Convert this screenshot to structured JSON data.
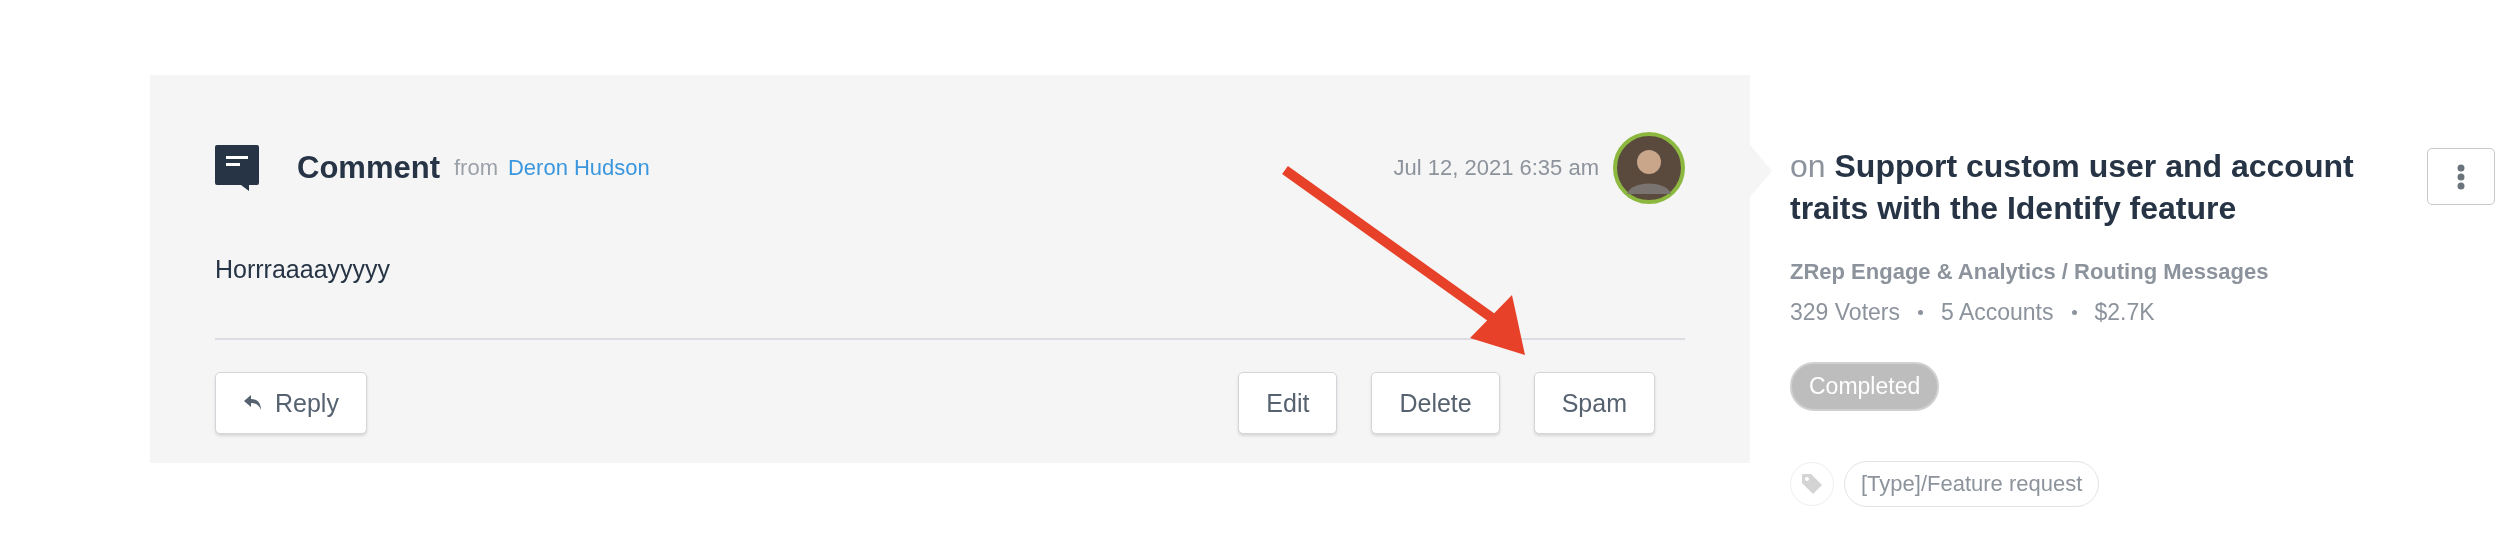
{
  "comment": {
    "type": "Comment",
    "from_label": "from",
    "author": "Deron Hudson",
    "timestamp": "Jul 12, 2021 6:35 am",
    "body": "Horrraaaayyyyy",
    "reply_button": "Reply",
    "actions": [
      "Edit",
      "Delete",
      "Spam"
    ]
  },
  "idea": {
    "prefix": "on",
    "title": "Support custom user and account traits with the Identify feature",
    "breadcrumb": "ZRep Engage & Analytics / Routing Messages",
    "stats": [
      "329 Voters",
      "5 Accounts",
      "$2.7K"
    ],
    "status": "Completed",
    "tags": [
      "[Type]/Feature request"
    ]
  }
}
